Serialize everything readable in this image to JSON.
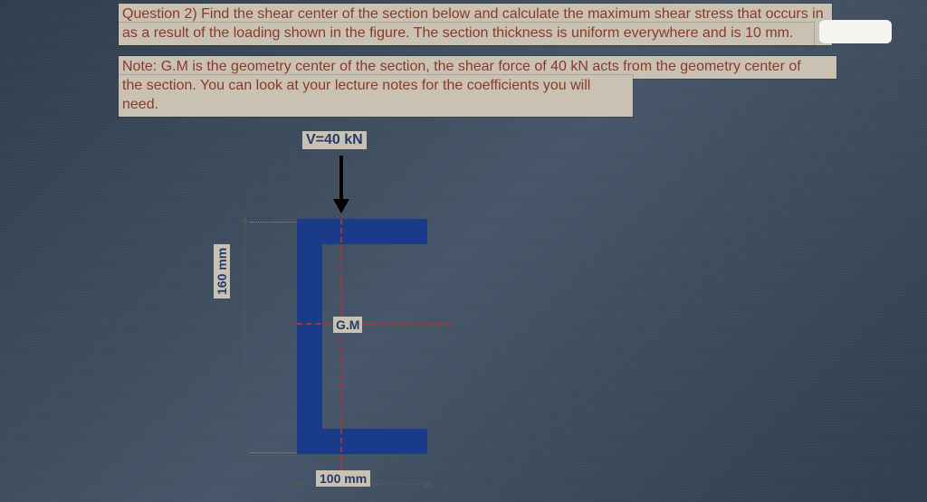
{
  "question": {
    "line1": "Question 2) Find the shear center of the section below and calculate the maximum shear stress that occurs in the section",
    "line2": "as a result of the loading shown in the figure. The section thickness is uniform everywhere and is 10 mm."
  },
  "note": {
    "line1": "Note: G.M is the geometry center of the section, the shear force of 40 kN acts from the geometry center of",
    "line2": "the section. You can look at your lecture notes for the coefficients you will need."
  },
  "figure": {
    "force_label": "V=40 kN",
    "gm_label": "G.M",
    "dim_height": "160 mm",
    "dim_width": "100 mm"
  },
  "diagram_data": {
    "section_type": "C-channel",
    "orientation": "open side right",
    "uniform_thickness_mm": 10,
    "height_mm": 160,
    "flange_width_mm": 100,
    "applied_shear_force_kN": 40,
    "force_direction": "downward",
    "force_applied_at": "geometry center (G.M)",
    "task": [
      "find shear center location",
      "calculate maximum shear stress"
    ]
  }
}
